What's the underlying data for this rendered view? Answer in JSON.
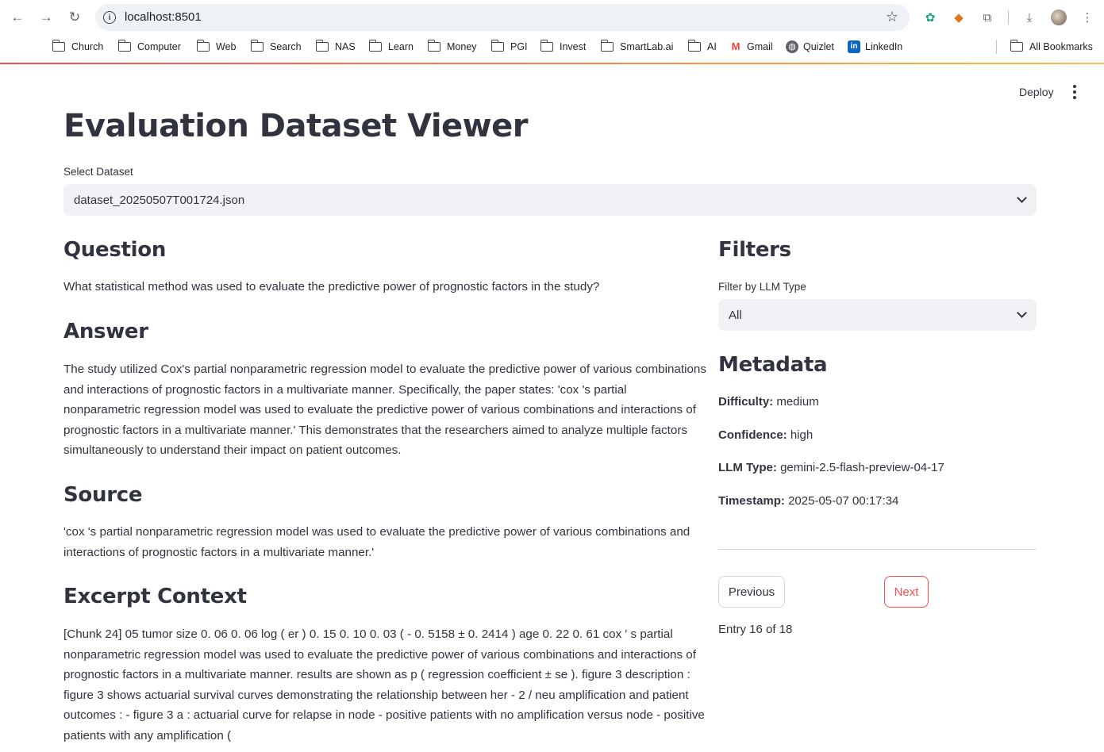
{
  "browser": {
    "url": "localhost:8501",
    "bookmarks": [
      "Church",
      "Computer",
      "Web",
      "Search",
      "NAS",
      "Learn",
      "Money",
      "PGI",
      "Invest",
      "SmartLab.ai",
      "AI",
      "Gmail",
      "Quizlet",
      "LinkedIn"
    ],
    "all_bookmarks": "All Bookmarks"
  },
  "app": {
    "deploy_label": "Deploy",
    "title": "Evaluation Dataset Viewer",
    "select_dataset_label": "Select Dataset",
    "selected_dataset": "dataset_20250507T001724.json"
  },
  "main": {
    "question_heading": "Question",
    "question": "What statistical method was used to evaluate the predictive power of prognostic factors in the study?",
    "answer_heading": "Answer",
    "answer": "The study utilized Cox's partial nonparametric regression model to evaluate the predictive power of various combinations and interactions of prognostic factors in a multivariate manner. Specifically, the paper states: 'cox 's partial nonparametric regression model was used to evaluate the predictive power of various combinations and interactions of prognostic factors in a multivariate manner.' This demonstrates that the researchers aimed to analyze multiple factors simultaneously to understand their impact on patient outcomes.",
    "source_heading": "Source",
    "source": "'cox 's partial nonparametric regression model was used to evaluate the predictive power of various combinations and interactions of prognostic factors in a multivariate manner.'",
    "excerpt_heading": "Excerpt Context",
    "excerpt": "[Chunk 24] 05 tumor size 0. 06 0. 06 log ( er ) 0. 15 0. 10 0. 03 ( - 0. 5158 ± 0. 2414 ) age 0. 22 0. 61 cox ' s partial nonparametric regression model was used to evaluate the predictive power of various combinations and interactions of prognostic factors in a multivariate manner. results are shown as p ( regression coefficient ± se ). figure 3 description : figure 3 shows actuarial survival curves demonstrating the relationship between her - 2 / neu amplification and patient outcomes : - figure 3 a : actuarial curve for relapse in node - positive patients with no amplification versus node - positive patients with any amplification ("
  },
  "sidebar": {
    "filters_heading": "Filters",
    "filter_label": "Filter by LLM Type",
    "filter_value": "All",
    "metadata_heading": "Metadata",
    "difficulty_label": "Difficulty:",
    "difficulty": "medium",
    "confidence_label": "Confidence:",
    "confidence": "high",
    "llm_type_label": "LLM Type:",
    "llm_type": "gemini-2.5-flash-preview-04-17",
    "timestamp_label": "Timestamp:",
    "timestamp": "2025-05-07 00:17:34",
    "previous_label": "Previous",
    "next_label": "Next",
    "entry_counter": "Entry 16 of 18"
  },
  "colors": {
    "accent": "#ff4b4b",
    "text": "#31333f",
    "input_bg": "#f0f2f6"
  }
}
